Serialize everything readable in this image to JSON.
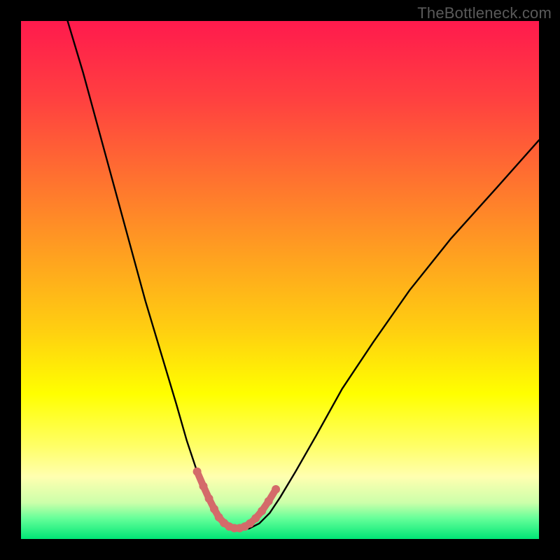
{
  "watermark": "TheBottleneck.com",
  "chart_data": {
    "type": "line",
    "title": "",
    "xlabel": "",
    "ylabel": "",
    "xlim": [
      0,
      100
    ],
    "ylim": [
      0,
      100
    ],
    "series": [
      {
        "name": "bottleneck-curve",
        "x": [
          9,
          12,
          15,
          18,
          21,
          24,
          27,
          30,
          32,
          34,
          36,
          37.5,
          39,
          40.5,
          42,
          44,
          46,
          48,
          50,
          53,
          57,
          62,
          68,
          75,
          83,
          92,
          100
        ],
        "y": [
          100,
          90,
          79,
          68,
          57,
          46,
          36,
          26,
          19,
          13,
          8,
          5,
          3,
          2,
          2,
          2,
          3,
          5,
          8,
          13,
          20,
          29,
          38,
          48,
          58,
          68,
          77
        ]
      }
    ],
    "highlight": {
      "name": "valley-highlight",
      "color": "#d46a6a",
      "x": [
        34,
        35.2,
        36.3,
        37.3,
        38.2,
        39.2,
        40.2,
        41.2,
        42.2,
        43.2,
        44.2,
        45.3,
        46.5,
        47.8,
        49.2
      ],
      "y": [
        13,
        10.2,
        7.8,
        5.8,
        4.2,
        3.1,
        2.4,
        2.1,
        2.1,
        2.4,
        3.0,
        4.0,
        5.4,
        7.3,
        9.6
      ]
    }
  }
}
